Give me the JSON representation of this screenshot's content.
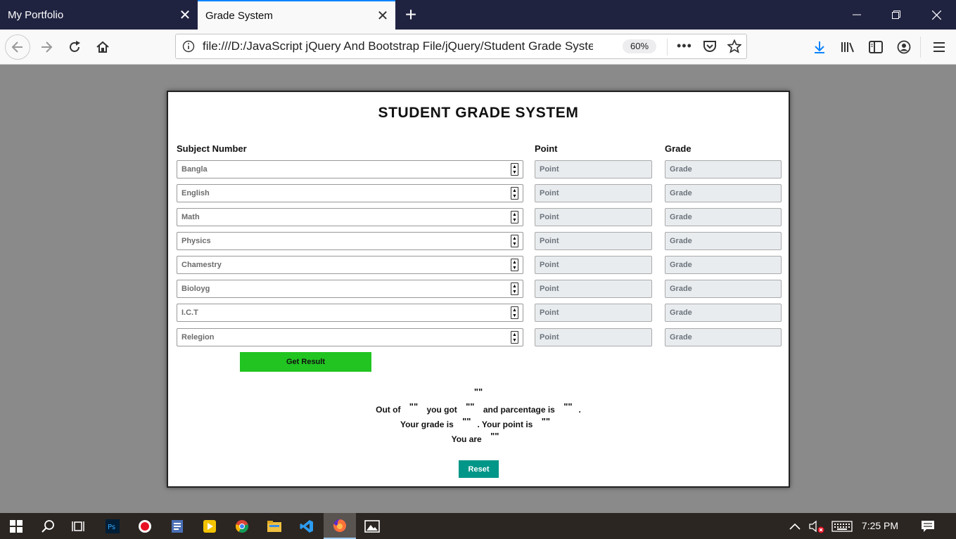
{
  "browser": {
    "tabs": [
      {
        "title": "My Portfolio",
        "active": false
      },
      {
        "title": "Grade System",
        "active": true
      }
    ],
    "url": "file:///D:/JavaScript jQuery And Bootstrap File/jQuery/Student Grade System",
    "zoom": "60%"
  },
  "page": {
    "title": "STUDENT GRADE SYSTEM",
    "headers": {
      "subject": "Subject Number",
      "point": "Point",
      "grade": "Grade"
    },
    "subjects": [
      {
        "placeholder": "Bangla",
        "point": "Point",
        "grade": "Grade"
      },
      {
        "placeholder": "English",
        "point": "Point",
        "grade": "Grade"
      },
      {
        "placeholder": "Math",
        "point": "Point",
        "grade": "Grade"
      },
      {
        "placeholder": "Physics",
        "point": "Point",
        "grade": "Grade"
      },
      {
        "placeholder": "Chamestry",
        "point": "Point",
        "grade": "Grade"
      },
      {
        "placeholder": "Bioloyg",
        "point": "Point",
        "grade": "Grade"
      },
      {
        "placeholder": "I.C.T",
        "point": "Point",
        "grade": "Grade"
      },
      {
        "placeholder": "Relegion",
        "point": "Point",
        "grade": "Grade"
      }
    ],
    "get_result_label": "Get Result",
    "result": {
      "heading": "\"\"",
      "out_of_label": "Out of",
      "out_of_value": "\"\"",
      "you_got_label": "you got",
      "you_got_value": "\"\"",
      "percentage_label": "and parcentage is",
      "percentage_value": "\"\"",
      "percentage_end": ".",
      "grade_label": "Your grade is",
      "grade_value": "\"\"",
      "point_label": ". Your point is",
      "point_value": "\"\"",
      "you_are_label": "You are",
      "you_are_value": "\"\""
    },
    "reset_label": "Reset"
  },
  "taskbar": {
    "time": "7:25 PM"
  }
}
